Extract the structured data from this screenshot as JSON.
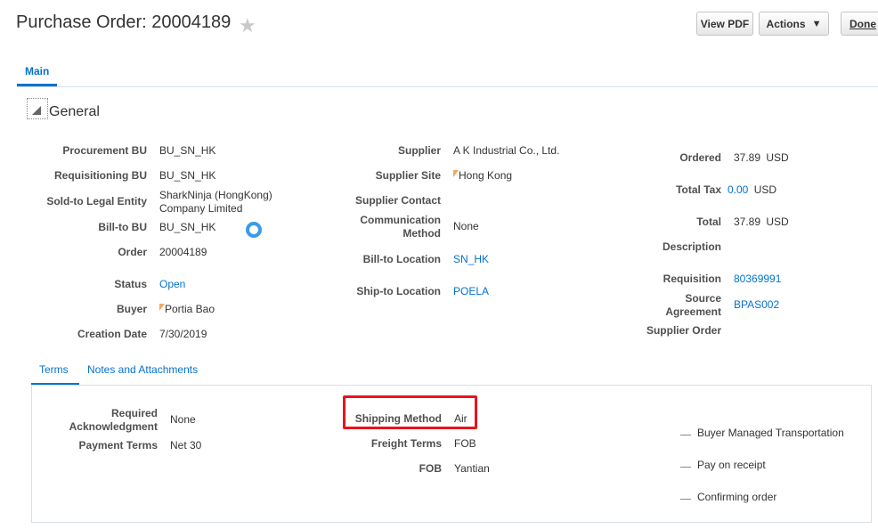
{
  "header": {
    "title": "Purchase Order: 20004189",
    "view_pdf": "View PDF",
    "actions": "Actions",
    "actions_arrow": "▼",
    "done": "Done"
  },
  "tabs": {
    "main": "Main"
  },
  "general": {
    "section_title": "General",
    "col1": [
      {
        "label": "Procurement BU",
        "value": "BU_SN_HK"
      },
      {
        "label": "Requisitioning BU",
        "value": "BU_SN_HK"
      },
      {
        "label": "Sold-to Legal Entity",
        "value_line1": "SharkNinja (HongKong)",
        "value_line2": "Company Limited"
      },
      {
        "label": "Bill-to BU",
        "value": "BU_SN_HK"
      },
      {
        "label": "Order",
        "value": "20004189"
      },
      {
        "label": "Status",
        "value": "Open"
      },
      {
        "label": "Buyer",
        "value": "Portia Bao"
      },
      {
        "label": "Creation Date",
        "value": "7/30/2019"
      }
    ],
    "col2": [
      {
        "label": "Supplier",
        "value": "A K Industrial Co., Ltd."
      },
      {
        "label": "Supplier Site",
        "value": "Hong Kong"
      },
      {
        "label": "Supplier Contact",
        "value": ""
      },
      {
        "label_line1": "Communication",
        "label_line2": "Method",
        "value": "None"
      },
      {
        "label": "Bill-to Location",
        "value": "SN_HK"
      },
      {
        "label": "Ship-to Location",
        "value": "POELA"
      }
    ],
    "col3": [
      {
        "label": "Ordered",
        "value": "37.89",
        "unit": "USD"
      },
      {
        "label": "Total Tax",
        "value": "0.00",
        "unit": "USD"
      },
      {
        "label": "Total",
        "value": "37.89",
        "unit": "USD"
      },
      {
        "label": "Description",
        "value": ""
      },
      {
        "label": "Requisition",
        "value": "80369991"
      },
      {
        "label_line1": "Source",
        "label_line2": "Agreement",
        "value": "BPAS002"
      },
      {
        "label": "Supplier Order",
        "value": ""
      }
    ]
  },
  "subtabs": {
    "terms": "Terms",
    "notes": "Notes and Attachments"
  },
  "terms": {
    "col1": [
      {
        "label_line1": "Required",
        "label_line2": "Acknowledgment",
        "value": "None"
      },
      {
        "label": "Payment Terms",
        "value": "Net 30"
      }
    ],
    "col2": [
      {
        "label": "Shipping Method",
        "value": "Air"
      },
      {
        "label": "Freight Terms",
        "value": "FOB"
      },
      {
        "label": "FOB",
        "value": "Yantian"
      }
    ],
    "checkboxes": [
      {
        "label": "Buyer Managed Transportation"
      },
      {
        "label": "Pay on receipt"
      },
      {
        "label": "Confirming order"
      }
    ]
  },
  "colors": {
    "accent": "#0572ce",
    "highlight": "#e8141c"
  }
}
